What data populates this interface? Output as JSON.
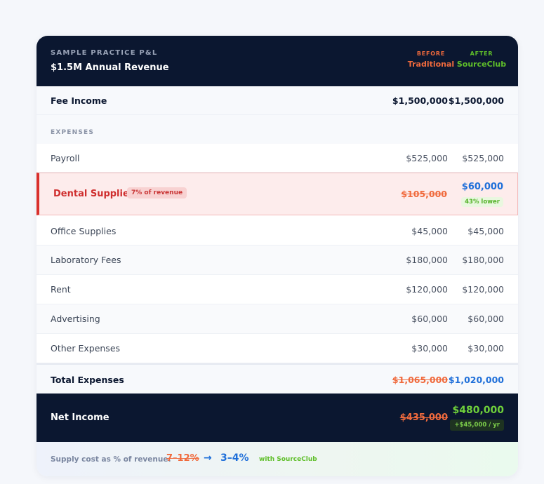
{
  "header": {
    "eyebrow": "SAMPLE PRACTICE P&L",
    "title": "$1.5M Annual Revenue",
    "before_key": "BEFORE",
    "before_value": "Traditional",
    "after_key": "AFTER",
    "after_value": "SourceClub"
  },
  "fee_income": {
    "label": "Fee Income",
    "before": "$1,500,000",
    "after": "$1,500,000"
  },
  "expenses_label": "EXPENSES",
  "rows": [
    {
      "label": "Payroll",
      "before": "$525,000",
      "after": "$525,000"
    },
    {
      "label": "Office Supplies",
      "before": "$45,000",
      "after": "$45,000"
    },
    {
      "label": "Laboratory Fees",
      "before": "$180,000",
      "after": "$180,000"
    },
    {
      "label": "Rent",
      "before": "$120,000",
      "after": "$120,000"
    },
    {
      "label": "Advertising",
      "before": "$60,000",
      "after": "$60,000"
    },
    {
      "label": "Other Expenses",
      "before": "$30,000",
      "after": "$30,000"
    }
  ],
  "dental": {
    "label": "Dental Supplies",
    "badge": "7% of revenue",
    "before": "$105,000",
    "after": "$60,000",
    "savings_badge": "43% lower"
  },
  "total": {
    "label": "Total Expenses",
    "before": "$1,065,000",
    "after": "$1,020,000"
  },
  "net": {
    "label": "Net Income",
    "before": "$435,000",
    "after": "$480,000",
    "gain_badge": "+$45,000 / yr"
  },
  "footer": {
    "label": "Supply cost as % of revenue:",
    "old": "7–12%",
    "arrow": "→",
    "new": "3–4%",
    "with": "with SourceClub"
  },
  "colors": {
    "navy": "#0b1730",
    "orange": "#f06a3d",
    "green": "#5fbf2a",
    "blue": "#1f6fd9",
    "red": "#cf2e2e"
  }
}
